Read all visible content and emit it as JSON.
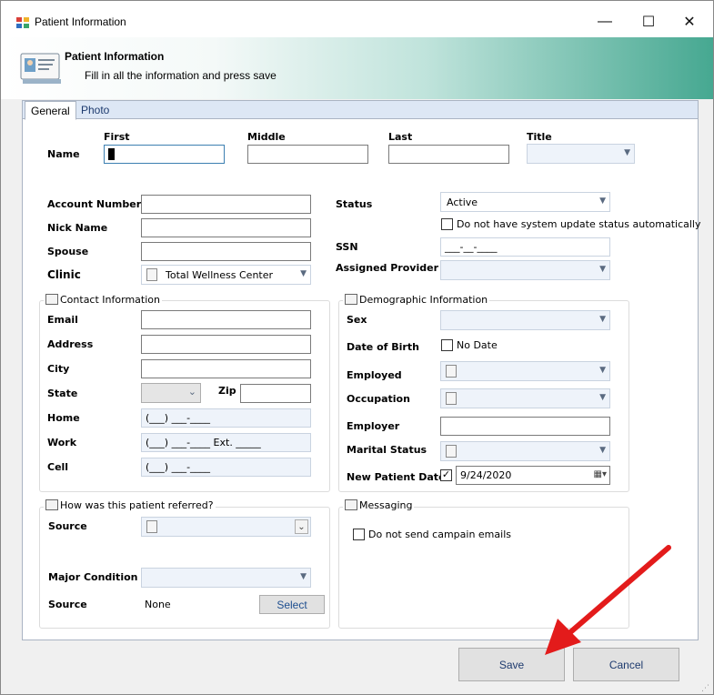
{
  "window": {
    "title": "Patient Information",
    "minimize_glyph": "—",
    "maximize_glyph": "☐",
    "close_glyph": "✕"
  },
  "banner": {
    "title": "Patient Information",
    "subtitle": "Fill in all the information and press save"
  },
  "tabs": [
    {
      "label": "General",
      "active": true
    },
    {
      "label": "Photo",
      "active": false
    }
  ],
  "name": {
    "label": "Name",
    "first_label": "First",
    "middle_label": "Middle",
    "last_label": "Last",
    "title_label": "Title",
    "first_value": "",
    "middle_value": "",
    "last_value": "",
    "title_value": ""
  },
  "account": {
    "account_number_label": "Account Number",
    "nick_name_label": "Nick Name",
    "spouse_label": "Spouse",
    "clinic_label": "Clinic",
    "clinic_value": "Total Wellness Center",
    "account_number_value": "",
    "nick_name_value": "",
    "spouse_value": ""
  },
  "status": {
    "status_label": "Status",
    "status_value": "Active",
    "no_auto_update_label": "Do not have system update status automatically",
    "ssn_label": "SSN",
    "ssn_mask": "___-__-____",
    "assigned_provider_label": "Assigned Provider",
    "assigned_provider_value": ""
  },
  "contact": {
    "group_title": "Contact Information",
    "email_label": "Email",
    "address_label": "Address",
    "city_label": "City",
    "state_label": "State",
    "zip_label": "Zip",
    "home_label": "Home",
    "work_label": "Work",
    "cell_label": "Cell",
    "home_mask": "(___) ___-____",
    "work_mask": "(___) ___-____ Ext. _____",
    "cell_mask": "(___) ___-____"
  },
  "demographic": {
    "group_title": "Demographic Information",
    "sex_label": "Sex",
    "dob_label": "Date of Birth",
    "no_date_label": "No Date",
    "employed_label": "Employed",
    "occupation_label": "Occupation",
    "employer_label": "Employer",
    "marital_label": "Marital Status",
    "new_patient_date_label": "New Patient Date",
    "new_patient_date_value": "9/24/2020",
    "new_patient_checked": true
  },
  "referral": {
    "group_title": "How was this patient referred?",
    "source_label": "Source",
    "major_condition_label": "Major Condition",
    "source2_label": "Source",
    "source2_value": "None",
    "select_button": "Select"
  },
  "messaging": {
    "group_title": "Messaging",
    "no_campaign_label": "Do not send campain emails"
  },
  "footer": {
    "save_label": "Save",
    "cancel_label": "Cancel"
  },
  "annotation": {
    "arrow_color": "#e31b1b"
  }
}
